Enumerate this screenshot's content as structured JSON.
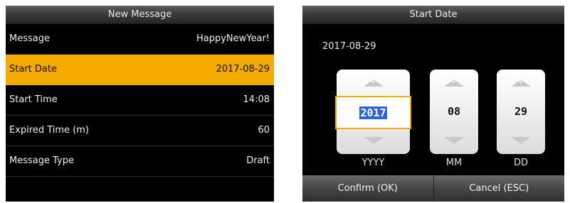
{
  "left_screen": {
    "title": "New Message",
    "rows": [
      {
        "label": "Message",
        "value": "HappyNewYear!"
      },
      {
        "label": "Start Date",
        "value": "2017-08-29"
      },
      {
        "label": "Start Time",
        "value": "14:08"
      },
      {
        "label": "Expired Time (m)",
        "value": "60"
      },
      {
        "label": "Message Type",
        "value": "Draft"
      }
    ],
    "selected_row": "Start Date"
  },
  "right_screen": {
    "title": "Start Date",
    "current_date": "2017-08-29",
    "spinners": [
      {
        "value": "2017",
        "unit": "YYYY"
      },
      {
        "value": "08",
        "unit": "MM"
      },
      {
        "value": "29",
        "unit": "DD"
      }
    ],
    "confirm_label": "Confirm (OK)",
    "cancel_label": "Cancel (ESC)"
  },
  "colors": {
    "highlight": "#f5aa00",
    "text_selection": "#2e62d6",
    "screen_bg": "#000000"
  }
}
